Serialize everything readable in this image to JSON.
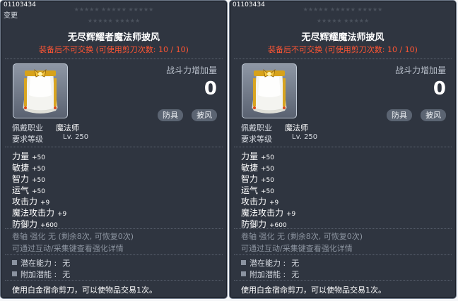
{
  "tooltips": [
    {
      "item_id": "01103434",
      "changed_label": "变更",
      "stars_row1": "★★★★★ ★★★★★ ★★★★★",
      "stars_row2": "★★★★★ ★★★★★",
      "name": "无尽辉耀者魔法师披风",
      "trade_note": "装备后不可交换 (可使用剪刀次数: 10 / 10)",
      "power_label": "战斗力增加量",
      "power_value": "0",
      "tags": [
        "防具",
        "披风"
      ],
      "job_label": "佩戴职业",
      "job_value": "魔法师",
      "level_label": "要求等级",
      "level_value": "Lv. 250",
      "stats": [
        {
          "label": "力量",
          "value": "+50"
        },
        {
          "label": "敏捷",
          "value": "+50"
        },
        {
          "label": "智力",
          "value": "+50"
        },
        {
          "label": "运气",
          "value": "+50"
        },
        {
          "label": "攻击力",
          "value": "+9"
        },
        {
          "label": "魔法攻击力",
          "value": "+9"
        },
        {
          "label": "防御力",
          "value": "+600"
        }
      ],
      "scroll_info": "卷轴 强化 无 (剩余8次, 可恢复0次)",
      "upgrade_hint": "可通过互动/采集键查看强化详情",
      "potential_label": "潜在能力 :",
      "potential_value": "无",
      "additional_label": "附加潜能 :",
      "additional_value": "无",
      "scissors_note": "使用白金宿命剪刀，可以使物品交易1次。"
    },
    {
      "item_id": "01103434",
      "changed_label": "",
      "stars_row1": "★★★★★ ★★★★★ ★★★★★",
      "stars_row2": "★★★★★ ★★★★★",
      "name": "无尽辉耀魔法师披风",
      "trade_note": "装备后不可交换 (可使用剪刀次数: 10 / 10)",
      "power_label": "战斗力增加量",
      "power_value": "0",
      "tags": [
        "防具",
        "披风"
      ],
      "job_label": "佩戴职业",
      "job_value": "魔法师",
      "level_label": "要求等级",
      "level_value": "Lv. 250",
      "stats": [
        {
          "label": "力量",
          "value": "+50"
        },
        {
          "label": "敏捷",
          "value": "+50"
        },
        {
          "label": "智力",
          "value": "+50"
        },
        {
          "label": "运气",
          "value": "+50"
        },
        {
          "label": "攻击力",
          "value": "+9"
        },
        {
          "label": "魔法攻击力",
          "value": "+9"
        },
        {
          "label": "防御力",
          "value": "+600"
        }
      ],
      "scroll_info": "卷轴 强化 无 (剩余8次, 可恢复0次)",
      "upgrade_hint": "可通过互动/采集键查看强化详情",
      "potential_label": "潜在能力 :",
      "potential_value": "无",
      "additional_label": "附加潜能 :",
      "additional_value": "无",
      "scissors_note": "使用白金宿命剪刀，可以使物品交易1次。"
    }
  ]
}
